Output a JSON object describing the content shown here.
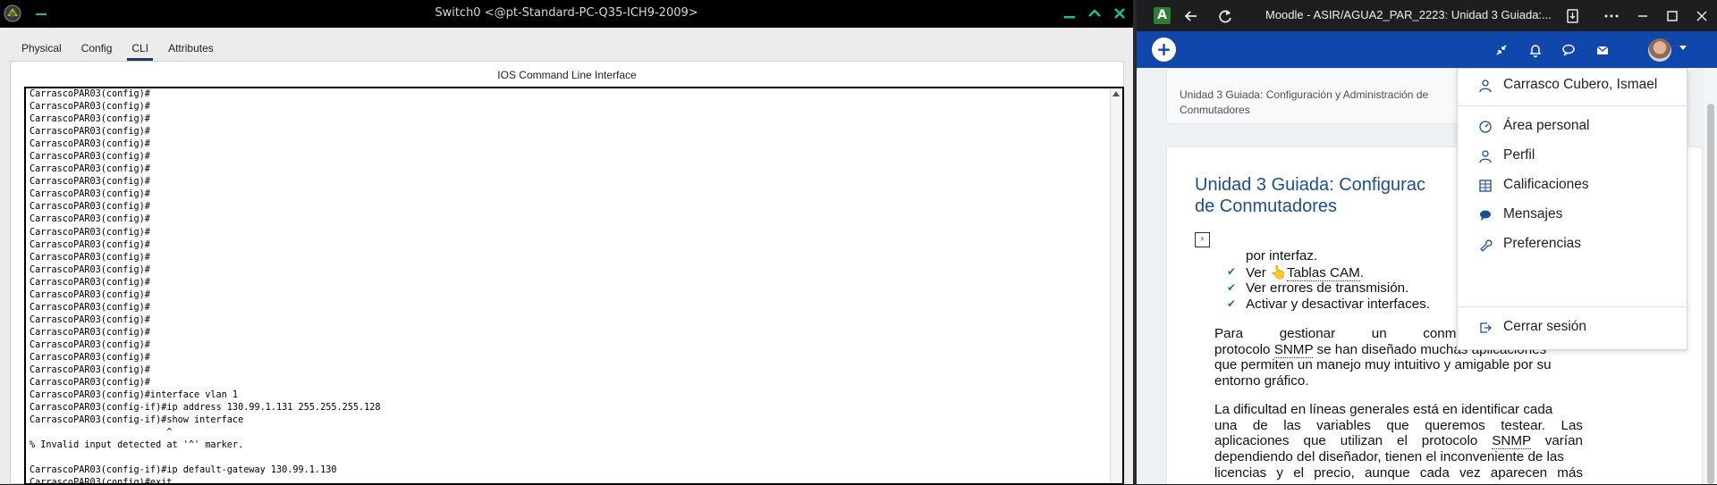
{
  "pt": {
    "title": "Switch0 <@pt-Standard-PC-Q35-ICH9-2009>",
    "tabs": [
      "Physical",
      "Config",
      "CLI",
      "Attributes"
    ],
    "active_tab": "CLI",
    "panel_title": "IOS Command Line Interface",
    "terminal_lines": [
      "CarrascoPAR03(config)#",
      "CarrascoPAR03(config)#",
      "CarrascoPAR03(config)#",
      "CarrascoPAR03(config)#",
      "CarrascoPAR03(config)#",
      "CarrascoPAR03(config)#",
      "CarrascoPAR03(config)#",
      "CarrascoPAR03(config)#",
      "CarrascoPAR03(config)#",
      "CarrascoPAR03(config)#",
      "CarrascoPAR03(config)#",
      "CarrascoPAR03(config)#",
      "CarrascoPAR03(config)#",
      "CarrascoPAR03(config)#",
      "CarrascoPAR03(config)#",
      "CarrascoPAR03(config)#",
      "CarrascoPAR03(config)#",
      "CarrascoPAR03(config)#",
      "CarrascoPAR03(config)#",
      "CarrascoPAR03(config)#",
      "CarrascoPAR03(config)#",
      "CarrascoPAR03(config)#",
      "CarrascoPAR03(config)#",
      "CarrascoPAR03(config)#",
      "CarrascoPAR03(config)#interface vlan 1",
      "CarrascoPAR03(config-if)#ip address 130.99.1.131 255.255.255.128",
      "CarrascoPAR03(config-if)#show interface",
      "                         ^",
      "% Invalid input detected at '^' marker.",
      "",
      "CarrascoPAR03(config-if)#ip default-gateway 130.99.1.130",
      "CarrascoPAR03(config)#exit"
    ]
  },
  "browser": {
    "title": "Moodle - ASIR/AGUA2_PAR_2223: Unidad 3 Guiada:...",
    "logo_letter": "A",
    "breadcrumb": "Unidad 3 Guiada: Configuración y Administración de Conmutadores",
    "heading_line1": "Unidad 3 Guiada: Configurac",
    "heading_line2": "de Conmutadores",
    "toggle_glyph": "›",
    "list_partial": "por interfaz.",
    "list_items": [
      {
        "prefix": "Ver ",
        "link": "Tablas CAM",
        "suffix": "."
      },
      {
        "prefix": "Ver errores de transmisión.",
        "link": "",
        "suffix": ""
      },
      {
        "prefix": "Activar y desactivar interfaces.",
        "link": "",
        "suffix": ""
      }
    ],
    "para1": {
      "line1_left": "Para",
      "line1_mid": "gestionar",
      "line1_mid2": "un",
      "line1_right": "conmutad",
      "line2_a": "protocolo ",
      "line2_link": "SNMP",
      "line2_b": " se han diseñado muchas aplicaciones",
      "line3": "que permiten un manejo muy intuitivo y amigable por su",
      "line4": "entorno gráfico."
    },
    "para2": {
      "line1": "La dificultad en líneas generales está en identificar cada",
      "line2": "una de las variables que queremos testear. Las",
      "line3_a": "aplicaciones que utilizan el protocolo ",
      "line3_link": "SNMP",
      "line3_b": " varían",
      "line4": "dependiendo del diseñador, tienen el inconveniente de las",
      "line5": "licencias y el precio, aunque cada vez aparecen más"
    },
    "user_menu": {
      "name": "Carrasco Cubero, Ismael",
      "items": [
        "Área personal",
        "Perfil",
        "Calificaciones",
        "Mensajes",
        "Preferencias"
      ],
      "logout": "Cerrar sesión"
    }
  }
}
